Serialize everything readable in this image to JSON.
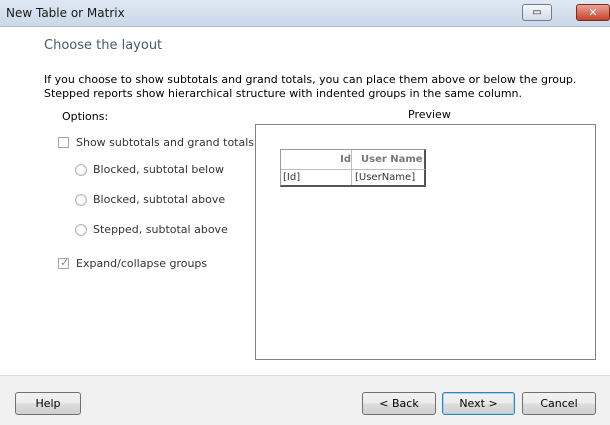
{
  "window": {
    "title": "New Table or Matrix",
    "restore_icon": "▭",
    "close_icon": "✕"
  },
  "page": {
    "heading": "Choose the layout",
    "description_line1": "If you choose to show subtotals and grand totals, you can place them above or below the group.",
    "description_line2": "Stepped reports show hierarchical structure with indented groups in the same column."
  },
  "options": {
    "label": "Options:",
    "show_subtotals": {
      "label": "Show subtotals and grand totals",
      "checked": false
    },
    "radios": [
      {
        "label": "Blocked, subtotal below"
      },
      {
        "label": "Blocked, subtotal above"
      },
      {
        "label": "Stepped, subtotal above"
      }
    ],
    "expand_collapse": {
      "label": "Expand/collapse groups",
      "checked": true
    }
  },
  "preview": {
    "label": "Preview",
    "headers": [
      "Id",
      "User Name"
    ],
    "row": [
      "[Id]",
      "[UserName]"
    ]
  },
  "buttons": {
    "help": "Help",
    "back": "< Back",
    "next": "Next >",
    "cancel": "Cancel"
  }
}
